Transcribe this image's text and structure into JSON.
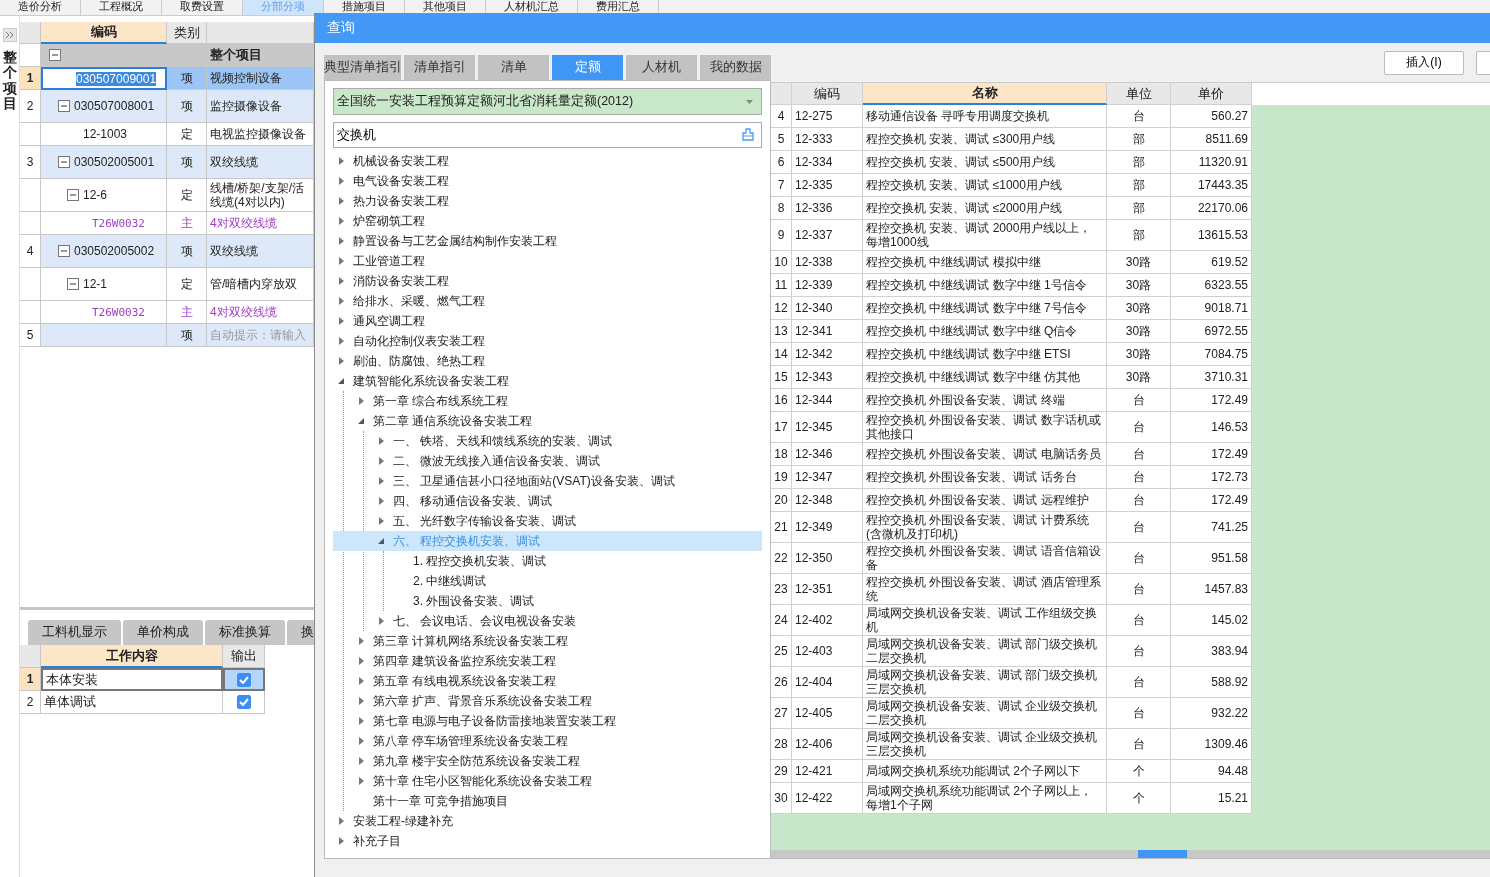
{
  "app_tabs": [
    {
      "label": "造价分析",
      "selected": false
    },
    {
      "label": "工程概况",
      "selected": false
    },
    {
      "label": "取费设置",
      "selected": false
    },
    {
      "label": "分部分项",
      "selected": true
    },
    {
      "label": "措施项目",
      "selected": false
    },
    {
      "label": "其他项目",
      "selected": false
    },
    {
      "label": "人材机汇总",
      "selected": false
    },
    {
      "label": "费用汇总",
      "selected": false
    }
  ],
  "side_strip": {
    "title": "整个项目"
  },
  "project_grid": {
    "columns": [
      "编码",
      "类别"
    ],
    "root": {
      "name": "整个项目",
      "expanded": true,
      "children": [
        {
          "row": "1",
          "code": "030507009001",
          "category": "项",
          "name": "视频控制设备",
          "kind": "item",
          "selected": true
        },
        {
          "row": "2",
          "code": "030507008001",
          "category": "项",
          "name": "监控摄像设备",
          "kind": "item",
          "selected": false,
          "expanded": true,
          "children": [
            {
              "code": "12-1003",
              "category": "定",
              "name": "电视监控摄像设备",
              "kind": "quota",
              "selected": false
            }
          ]
        },
        {
          "row": "3",
          "code": "030502005001",
          "category": "项",
          "name": "双绞线缆",
          "kind": "item",
          "selected": false,
          "expanded": true,
          "children": [
            {
              "code": "12-6",
              "category": "定",
              "name": "线槽/桥架/支架/活线缆(4对以内)",
              "kind": "quota",
              "selected": false,
              "expanded": true,
              "children": [
                {
                  "code": "T26W0032",
                  "category": "主",
                  "name": "4对双绞线缆",
                  "kind": "material",
                  "selected": false
                }
              ]
            }
          ]
        },
        {
          "row": "4",
          "code": "030502005002",
          "category": "项",
          "name": "双绞线缆",
          "kind": "item",
          "selected": false,
          "expanded": true,
          "children": [
            {
              "code": "12-1",
              "category": "定",
              "name": "管/暗槽内穿放双",
              "kind": "quota",
              "selected": false,
              "expanded": true,
              "children": [
                {
                  "code": "T26W0032",
                  "category": "主",
                  "name": "4对双绞线缆",
                  "kind": "material",
                  "selected": false
                }
              ]
            }
          ]
        },
        {
          "row": "5",
          "category": "项",
          "placeholder": "自动提示：请输入",
          "kind": "item",
          "selected": false
        }
      ]
    }
  },
  "detail_tabs": [
    "工料机显示",
    "单价构成",
    "标准换算",
    "换"
  ],
  "work_content": {
    "columns": [
      "工作内容",
      "输出"
    ],
    "rows": [
      {
        "row": "1",
        "content": "本体安装",
        "output": true,
        "selected": true
      },
      {
        "row": "2",
        "content": "单体调试",
        "output": true,
        "selected": false
      }
    ]
  },
  "dialog": {
    "title": "查询",
    "tabs": [
      {
        "label": "典型清单指引",
        "selected": false
      },
      {
        "label": "清单指引",
        "selected": false
      },
      {
        "label": "清单",
        "selected": false
      },
      {
        "label": "定额",
        "selected": true
      },
      {
        "label": "人材机",
        "selected": false
      },
      {
        "label": "我的数据",
        "selected": false
      }
    ],
    "library": "全国统一安装工程预算定额河北省消耗量定额(2012)",
    "search": {
      "value": "交换机"
    },
    "tree": [
      {
        "label": "机械设备安装工程",
        "expanded": false,
        "selected": false
      },
      {
        "label": "电气设备安装工程",
        "expanded": false,
        "selected": false
      },
      {
        "label": "热力设备安装工程",
        "expanded": false,
        "selected": false
      },
      {
        "label": "炉窑砌筑工程",
        "expanded": false,
        "selected": false
      },
      {
        "label": "静置设备与工艺金属结构制作安装工程",
        "expanded": false,
        "selected": false
      },
      {
        "label": "工业管道工程",
        "expanded": false,
        "selected": false
      },
      {
        "label": "消防设备安装工程",
        "expanded": false,
        "selected": false
      },
      {
        "label": "给排水、采暖、燃气工程",
        "expanded": false,
        "selected": false
      },
      {
        "label": "通风空调工程",
        "expanded": false,
        "selected": false
      },
      {
        "label": "自动化控制仪表安装工程",
        "expanded": false,
        "selected": false
      },
      {
        "label": "刷油、防腐蚀、绝热工程",
        "expanded": false,
        "selected": false
      },
      {
        "label": "建筑智能化系统设备安装工程",
        "expanded": true,
        "selected": false,
        "children": [
          {
            "label": "第一章 综合布线系统工程",
            "expanded": false,
            "selected": false
          },
          {
            "label": "第二章 通信系统设备安装工程",
            "expanded": true,
            "selected": false,
            "children": [
              {
                "label": "一、 铁塔、天线和馈线系统的安装、调试",
                "expanded": false,
                "selected": false
              },
              {
                "label": "二、 微波无线接入通信设备安装、调试",
                "expanded": false,
                "selected": false
              },
              {
                "label": "三、 卫星通信甚小口径地面站(VSAT)设备安装、调试",
                "expanded": false,
                "selected": false
              },
              {
                "label": "四、 移动通信设备安装、调试",
                "expanded": false,
                "selected": false
              },
              {
                "label": "五、 光纤数字传输设备安装、调试",
                "expanded": false,
                "selected": false
              },
              {
                "label": "六、 程控交换机安装、调试",
                "expanded": true,
                "selected": true,
                "children": [
                  {
                    "label": "1. 程控交换机安装、调试",
                    "selected": false
                  },
                  {
                    "label": "2. 中继线调试",
                    "selected": false
                  },
                  {
                    "label": "3. 外围设备安装、调试",
                    "selected": false
                  }
                ]
              },
              {
                "label": "七、 会议电话、会议电视设备安装",
                "expanded": false,
                "selected": false
              }
            ]
          },
          {
            "label": "第三章 计算机网络系统设备安装工程",
            "expanded": false,
            "selected": false
          },
          {
            "label": "第四章 建筑设备监控系统安装工程",
            "expanded": false,
            "selected": false
          },
          {
            "label": "第五章 有线电视系统设备安装工程",
            "expanded": false,
            "selected": false
          },
          {
            "label": "第六章 扩声、背景音乐系统设备安装工程",
            "expanded": false,
            "selected": false
          },
          {
            "label": "第七章 电源与电子设备防雷接地装置安装工程",
            "expanded": false,
            "selected": false
          },
          {
            "label": "第八章 停车场管理系统设备安装工程",
            "expanded": false,
            "selected": false
          },
          {
            "label": "第九章 楼宇安全防范系统设备安装工程",
            "expanded": false,
            "selected": false
          },
          {
            "label": "第十章 住宅小区智能化系统设备安装工程",
            "expanded": false,
            "selected": false
          },
          {
            "label": "第十一章 可竞争措施项目",
            "selected": false
          }
        ]
      },
      {
        "label": "安装工程-绿建补充",
        "expanded": false,
        "selected": false
      },
      {
        "label": "补充子目",
        "expanded": false,
        "selected": false
      }
    ],
    "buttons": [
      "插入(I)"
    ],
    "table": {
      "columns": [
        "编码",
        "名称",
        "单位",
        "单价"
      ],
      "rows": [
        {
          "no": "4",
          "code": "12-275",
          "name": "移动通信设备 寻呼专用调度交换机",
          "unit": "台",
          "price": "560.27"
        },
        {
          "no": "5",
          "code": "12-333",
          "name": "程控交换机 安装、调试 ≤300用户线",
          "unit": "部",
          "price": "8511.69"
        },
        {
          "no": "6",
          "code": "12-334",
          "name": "程控交换机 安装、调试 ≤500用户线",
          "unit": "部",
          "price": "11320.91"
        },
        {
          "no": "7",
          "code": "12-335",
          "name": "程控交换机 安装、调试 ≤1000用户线",
          "unit": "部",
          "price": "17443.35"
        },
        {
          "no": "8",
          "code": "12-336",
          "name": "程控交换机 安装、调试 ≤2000用户线",
          "unit": "部",
          "price": "22170.06"
        },
        {
          "no": "9",
          "code": "12-337",
          "name": "程控交换机 安装、调试 2000用户线以上，每增1000线",
          "unit": "部",
          "price": "13615.53"
        },
        {
          "no": "10",
          "code": "12-338",
          "name": "程控交换机 中继线调试 模拟中继",
          "unit": "30路",
          "price": "619.52"
        },
        {
          "no": "11",
          "code": "12-339",
          "name": "程控交换机 中继线调试 数字中继 1号信令",
          "unit": "30路",
          "price": "6323.55"
        },
        {
          "no": "12",
          "code": "12-340",
          "name": "程控交换机 中继线调试 数字中继 7号信令",
          "unit": "30路",
          "price": "9018.71"
        },
        {
          "no": "13",
          "code": "12-341",
          "name": "程控交换机 中继线调试 数字中继 Q信令",
          "unit": "30路",
          "price": "6972.55"
        },
        {
          "no": "14",
          "code": "12-342",
          "name": "程控交换机 中继线调试 数字中继 ETSI",
          "unit": "30路",
          "price": "7084.75"
        },
        {
          "no": "15",
          "code": "12-343",
          "name": "程控交换机 中继线调试 数字中继 仿其他",
          "unit": "30路",
          "price": "3710.31"
        },
        {
          "no": "16",
          "code": "12-344",
          "name": "程控交换机 外围设备安装、调试 终端",
          "unit": "台",
          "price": "172.49"
        },
        {
          "no": "17",
          "code": "12-345",
          "name": "程控交换机 外围设备安装、调试 数字话机或其他接口",
          "unit": "台",
          "price": "146.53"
        },
        {
          "no": "18",
          "code": "12-346",
          "name": "程控交换机 外围设备安装、调试 电脑话务员",
          "unit": "台",
          "price": "172.49"
        },
        {
          "no": "19",
          "code": "12-347",
          "name": "程控交换机 外围设备安装、调试 话务台",
          "unit": "台",
          "price": "172.73"
        },
        {
          "no": "20",
          "code": "12-348",
          "name": "程控交换机 外围设备安装、调试 远程维护",
          "unit": "台",
          "price": "172.49"
        },
        {
          "no": "21",
          "code": "12-349",
          "name": "程控交换机 外围设备安装、调试 计费系统(含微机及打印机)",
          "unit": "台",
          "price": "741.25"
        },
        {
          "no": "22",
          "code": "12-350",
          "name": "程控交换机 外围设备安装、调试 语音信箱设备",
          "unit": "台",
          "price": "951.58"
        },
        {
          "no": "23",
          "code": "12-351",
          "name": "程控交换机 外围设备安装、调试 酒店管理系统",
          "unit": "台",
          "price": "1457.83"
        },
        {
          "no": "24",
          "code": "12-402",
          "name": "局域网交换机设备安装、调试 工作组级交换机",
          "unit": "台",
          "price": "145.02"
        },
        {
          "no": "25",
          "code": "12-403",
          "name": "局域网交换机设备安装、调试 部门级交换机二层交换机",
          "unit": "台",
          "price": "383.94"
        },
        {
          "no": "26",
          "code": "12-404",
          "name": "局域网交换机设备安装、调试 部门级交换机三层交换机",
          "unit": "台",
          "price": "588.92"
        },
        {
          "no": "27",
          "code": "12-405",
          "name": "局域网交换机设备安装、调试 企业级交换机二层交换机",
          "unit": "台",
          "price": "932.22"
        },
        {
          "no": "28",
          "code": "12-406",
          "name": "局域网交换机设备安装、调试 企业级交换机三层交换机",
          "unit": "台",
          "price": "1309.46"
        },
        {
          "no": "29",
          "code": "12-421",
          "name": "局域网交换机系统功能调试 2个子网以下",
          "unit": "个",
          "price": "94.48"
        },
        {
          "no": "30",
          "code": "12-422",
          "name": "局域网交换机系统功能调试 2个子网以上，每增1个子网",
          "unit": "个",
          "price": "15.21"
        }
      ]
    }
  }
}
